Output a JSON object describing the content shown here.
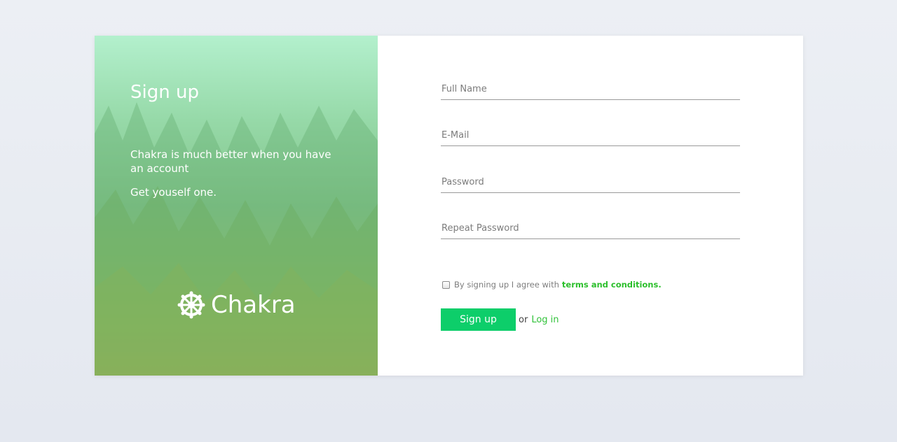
{
  "hero": {
    "title": "Sign up",
    "description": "Chakra is much better when you have an account",
    "subtext": "Get youself one.",
    "brand_name": "Chakra",
    "brand_icon": "dharma-wheel-icon"
  },
  "form": {
    "full_name": {
      "placeholder": "Full Name",
      "value": ""
    },
    "email": {
      "placeholder": "E-Mail",
      "value": ""
    },
    "password": {
      "placeholder": "Password",
      "value": ""
    },
    "repeat_password": {
      "placeholder": "Repeat Password",
      "value": ""
    },
    "agree_text": "By signing up I agree with",
    "terms_link": "terms and conditions.",
    "agree_checked": false,
    "submit_label": "Sign up",
    "or_text": "or",
    "login_link": "Log in"
  },
  "colors": {
    "accent": "#0dce6a",
    "link": "#2bbf2b",
    "hero_top": "#b3f0cd",
    "hero_bottom": "#b6b85c"
  }
}
